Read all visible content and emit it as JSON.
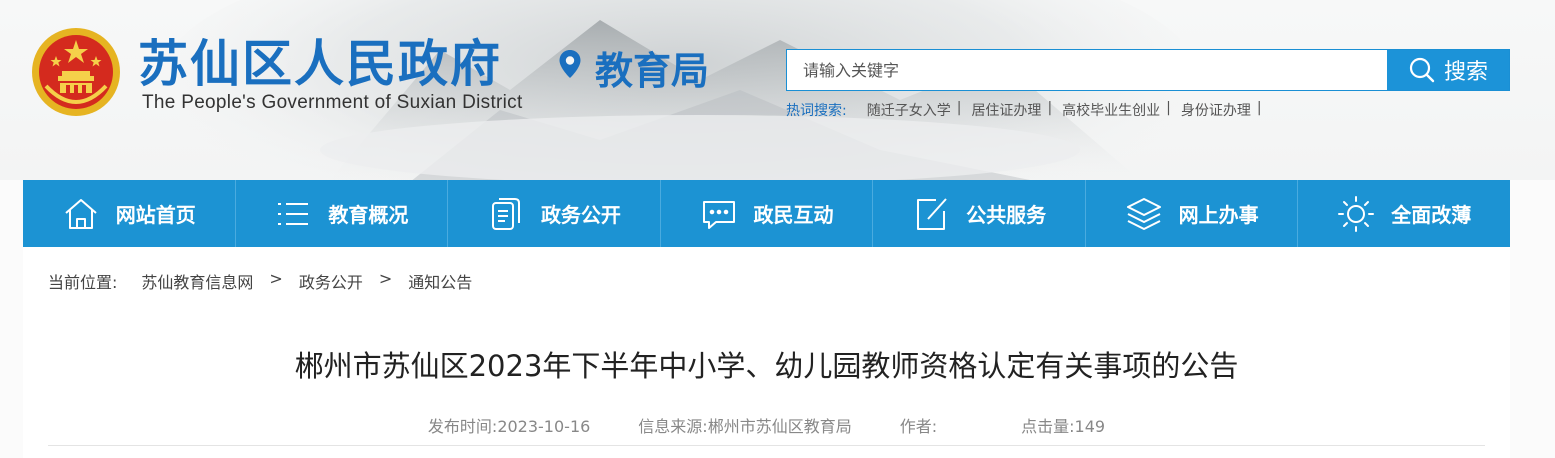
{
  "header": {
    "site_title": "苏仙区人民政府",
    "site_subtitle": "The People's Government of Suxian District",
    "department": "教育局",
    "emblem_icon": "national-emblem-icon",
    "location_icon": "map-pin-icon"
  },
  "search": {
    "placeholder": "请输入关键字",
    "button_label": "搜索",
    "button_icon": "search-icon",
    "hot_label": "热词搜索:",
    "hot_items": [
      "随迁子女入学",
      "居住证办理",
      "高校毕业生创业",
      "身份证办理"
    ],
    "separator": "|"
  },
  "nav": {
    "items": [
      {
        "label": "网站首页",
        "icon": "home-icon"
      },
      {
        "label": "教育概况",
        "icon": "list-icon"
      },
      {
        "label": "政务公开",
        "icon": "document-icon"
      },
      {
        "label": "政民互动",
        "icon": "chat-icon"
      },
      {
        "label": "公共服务",
        "icon": "edit-icon"
      },
      {
        "label": "网上办事",
        "icon": "layers-icon"
      },
      {
        "label": "全面改薄",
        "icon": "sun-icon"
      }
    ]
  },
  "breadcrumb": {
    "label": "当前位置:",
    "items": [
      "苏仙教育信息网",
      "政务公开",
      "通知公告"
    ],
    "separator": ">"
  },
  "article": {
    "title": "郴州市苏仙区2023年下半年中小学、幼儿园教师资格认定有关事项的公告",
    "publish_label": "发布时间:",
    "publish_date": "2023-10-16",
    "source_label": "信息来源:",
    "source": "郴州市苏仙区教育局",
    "author_label": "作者:",
    "author": "",
    "views_label": "点击量:",
    "views": "149"
  },
  "colors": {
    "brand_blue": "#1a6fbf",
    "nav_blue": "#1c93d3"
  }
}
